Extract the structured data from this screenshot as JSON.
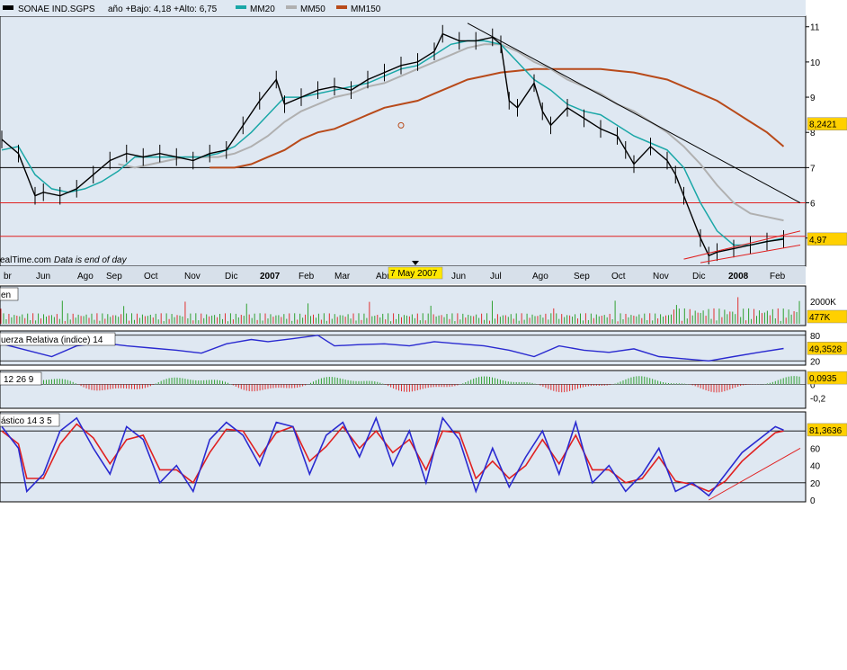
{
  "header": {
    "symbol": "SONAE IND.SGPS",
    "stats": "año +Bajo: 4,18 +Alto: 6,75",
    "legend": [
      {
        "name": "MM20",
        "color": "#1aa7a7"
      },
      {
        "name": "MM50",
        "color": "#b0b0b0"
      },
      {
        "name": "MM150",
        "color": "#b84a1a"
      }
    ]
  },
  "watermark": "ealTime.com",
  "eod_note": "Data is end of day",
  "date_marker": "7 May 2007",
  "panel_labels": {
    "volume": "en",
    "rsi": "uerza Relativa (indice) 14",
    "macd": "12 26 9",
    "stoch": "ástico 14 3 5"
  },
  "x_axis": {
    "labels": [
      {
        "t": "br",
        "bold": false
      },
      {
        "t": "Jun",
        "bold": false
      },
      {
        "t": "Ago",
        "bold": false
      },
      {
        "t": "Sep",
        "bold": false
      },
      {
        "t": "Oct",
        "bold": false
      },
      {
        "t": "Nov",
        "bold": false
      },
      {
        "t": "Dic",
        "bold": false
      },
      {
        "t": "2007",
        "bold": true
      },
      {
        "t": "Feb",
        "bold": false
      },
      {
        "t": "Mar",
        "bold": false
      },
      {
        "t": "Abr",
        "bold": false
      },
      {
        "t": "Jun",
        "bold": false
      },
      {
        "t": "Jul",
        "bold": false
      },
      {
        "t": "Ago",
        "bold": false
      },
      {
        "t": "Sep",
        "bold": false
      },
      {
        "t": "Oct",
        "bold": false
      },
      {
        "t": "Nov",
        "bold": false
      },
      {
        "t": "Dic",
        "bold": false
      },
      {
        "t": "2008",
        "bold": true
      },
      {
        "t": "Feb",
        "bold": false
      }
    ]
  },
  "chart_data": {
    "type": "line",
    "price": {
      "y_ticks": [
        "11",
        "10",
        "9",
        "8",
        "7",
        "6",
        "5"
      ],
      "ylim": [
        4.2,
        11.3
      ],
      "last_value_label": "4,97",
      "ref_value_label": "8,2421",
      "hlines": [
        {
          "value": 7.0,
          "color": "#000000"
        },
        {
          "value": 6.0,
          "color": "#e02020"
        },
        {
          "value": 5.05,
          "color": "#e02020"
        }
      ],
      "close_points": [
        [
          0,
          7.8
        ],
        [
          2,
          7.4
        ],
        [
          4,
          6.2
        ],
        [
          5,
          6.3
        ],
        [
          7,
          6.2
        ],
        [
          9,
          6.4
        ],
        [
          11,
          6.8
        ],
        [
          13,
          7.2
        ],
        [
          15,
          7.4
        ],
        [
          17,
          7.3
        ],
        [
          19,
          7.4
        ],
        [
          21,
          7.3
        ],
        [
          23,
          7.2
        ],
        [
          25,
          7.4
        ],
        [
          27,
          7.5
        ],
        [
          29,
          8.2
        ],
        [
          31,
          8.9
        ],
        [
          33,
          9.5
        ],
        [
          34,
          8.8
        ],
        [
          36,
          9.0
        ],
        [
          38,
          9.2
        ],
        [
          40,
          9.3
        ],
        [
          42,
          9.2
        ],
        [
          44,
          9.5
        ],
        [
          46,
          9.7
        ],
        [
          48,
          9.9
        ],
        [
          50,
          10.0
        ],
        [
          52,
          10.3
        ],
        [
          53,
          10.8
        ],
        [
          55,
          10.6
        ],
        [
          57,
          10.6
        ],
        [
          59,
          10.7
        ],
        [
          60,
          10.5
        ],
        [
          61,
          8.9
        ],
        [
          62,
          8.7
        ],
        [
          64,
          9.4
        ],
        [
          65,
          8.6
        ],
        [
          66,
          8.2
        ],
        [
          68,
          8.7
        ],
        [
          70,
          8.4
        ],
        [
          72,
          8.1
        ],
        [
          74,
          7.9
        ],
        [
          75,
          7.5
        ],
        [
          76,
          7.1
        ],
        [
          78,
          7.6
        ],
        [
          80,
          7.2
        ],
        [
          81,
          6.8
        ],
        [
          82,
          6.2
        ],
        [
          84,
          5.0
        ],
        [
          85,
          4.5
        ],
        [
          86,
          4.6
        ],
        [
          88,
          4.7
        ],
        [
          90,
          4.8
        ],
        [
          92,
          4.9
        ],
        [
          94,
          4.97
        ]
      ],
      "mm20": [
        [
          0,
          7.5
        ],
        [
          2,
          7.6
        ],
        [
          4,
          6.8
        ],
        [
          6,
          6.4
        ],
        [
          8,
          6.3
        ],
        [
          10,
          6.4
        ],
        [
          12,
          6.6
        ],
        [
          14,
          6.9
        ],
        [
          16,
          7.3
        ],
        [
          18,
          7.3
        ],
        [
          20,
          7.3
        ],
        [
          22,
          7.3
        ],
        [
          24,
          7.3
        ],
        [
          26,
          7.4
        ],
        [
          28,
          7.6
        ],
        [
          30,
          8.0
        ],
        [
          32,
          8.5
        ],
        [
          34,
          9.0
        ],
        [
          36,
          9.0
        ],
        [
          38,
          9.1
        ],
        [
          40,
          9.2
        ],
        [
          42,
          9.3
        ],
        [
          44,
          9.4
        ],
        [
          46,
          9.6
        ],
        [
          48,
          9.8
        ],
        [
          50,
          9.9
        ],
        [
          52,
          10.2
        ],
        [
          54,
          10.5
        ],
        [
          56,
          10.6
        ],
        [
          58,
          10.6
        ],
        [
          60,
          10.5
        ],
        [
          62,
          10.0
        ],
        [
          64,
          9.5
        ],
        [
          66,
          9.2
        ],
        [
          68,
          8.8
        ],
        [
          70,
          8.6
        ],
        [
          72,
          8.5
        ],
        [
          74,
          8.2
        ],
        [
          76,
          7.9
        ],
        [
          78,
          7.7
        ],
        [
          80,
          7.5
        ],
        [
          82,
          7.0
        ],
        [
          84,
          6.0
        ],
        [
          86,
          5.2
        ],
        [
          88,
          4.8
        ],
        [
          90,
          4.8
        ],
        [
          92,
          4.9
        ],
        [
          94,
          5.0
        ]
      ],
      "mm50": [
        [
          14,
          7.1
        ],
        [
          16,
          7.0
        ],
        [
          18,
          7.1
        ],
        [
          20,
          7.2
        ],
        [
          22,
          7.3
        ],
        [
          24,
          7.3
        ],
        [
          26,
          7.3
        ],
        [
          28,
          7.4
        ],
        [
          30,
          7.6
        ],
        [
          32,
          7.9
        ],
        [
          34,
          8.3
        ],
        [
          36,
          8.6
        ],
        [
          38,
          8.8
        ],
        [
          40,
          9.0
        ],
        [
          42,
          9.1
        ],
        [
          44,
          9.3
        ],
        [
          46,
          9.4
        ],
        [
          48,
          9.6
        ],
        [
          50,
          9.8
        ],
        [
          52,
          10.0
        ],
        [
          54,
          10.2
        ],
        [
          56,
          10.4
        ],
        [
          58,
          10.5
        ],
        [
          60,
          10.5
        ],
        [
          62,
          10.3
        ],
        [
          64,
          10.0
        ],
        [
          66,
          9.8
        ],
        [
          68,
          9.5
        ],
        [
          70,
          9.3
        ],
        [
          72,
          9.1
        ],
        [
          74,
          8.8
        ],
        [
          76,
          8.6
        ],
        [
          78,
          8.3
        ],
        [
          80,
          8.0
        ],
        [
          82,
          7.6
        ],
        [
          84,
          7.1
        ],
        [
          86,
          6.5
        ],
        [
          88,
          6.0
        ],
        [
          90,
          5.7
        ],
        [
          92,
          5.6
        ],
        [
          94,
          5.5
        ]
      ],
      "mm150": [
        [
          25,
          7.0
        ],
        [
          28,
          7.0
        ],
        [
          30,
          7.1
        ],
        [
          32,
          7.3
        ],
        [
          34,
          7.5
        ],
        [
          36,
          7.8
        ],
        [
          38,
          8.0
        ],
        [
          40,
          8.1
        ],
        [
          42,
          8.3
        ],
        [
          44,
          8.5
        ],
        [
          46,
          8.7
        ],
        [
          48,
          8.8
        ],
        [
          50,
          8.9
        ],
        [
          52,
          9.1
        ],
        [
          54,
          9.3
        ],
        [
          56,
          9.5
        ],
        [
          58,
          9.6
        ],
        [
          60,
          9.7
        ],
        [
          62,
          9.75
        ],
        [
          64,
          9.8
        ],
        [
          66,
          9.8
        ],
        [
          68,
          9.8
        ],
        [
          70,
          9.8
        ],
        [
          72,
          9.8
        ],
        [
          74,
          9.75
        ],
        [
          76,
          9.7
        ],
        [
          78,
          9.6
        ],
        [
          80,
          9.5
        ],
        [
          82,
          9.3
        ],
        [
          84,
          9.1
        ],
        [
          86,
          8.9
        ],
        [
          88,
          8.6
        ],
        [
          90,
          8.3
        ],
        [
          92,
          8.0
        ],
        [
          94,
          7.6
        ]
      ],
      "trendlines": [
        {
          "from": [
            56,
            11.1
          ],
          "to": [
            96,
            6.0
          ],
          "color": "#000000"
        },
        {
          "from": [
            82,
            4.4
          ],
          "to": [
            96,
            5.2
          ],
          "color": "#e02020"
        },
        {
          "from": [
            84,
            4.3
          ],
          "to": [
            96,
            4.8
          ],
          "color": "#e02020"
        }
      ]
    },
    "volume": {
      "y_ticks": [
        "2000K"
      ],
      "last_value_label": "477K",
      "ymax": 3000
    },
    "rsi": {
      "y_ticks": [
        "80",
        "20"
      ],
      "last_value_label": "49,3528",
      "ylim": [
        10,
        90
      ],
      "points": [
        [
          0,
          60
        ],
        [
          3,
          45
        ],
        [
          6,
          30
        ],
        [
          9,
          55
        ],
        [
          12,
          62
        ],
        [
          15,
          55
        ],
        [
          18,
          50
        ],
        [
          21,
          45
        ],
        [
          24,
          38
        ],
        [
          27,
          60
        ],
        [
          30,
          70
        ],
        [
          32,
          65
        ],
        [
          35,
          72
        ],
        [
          38,
          80
        ],
        [
          40,
          55
        ],
        [
          43,
          58
        ],
        [
          46,
          60
        ],
        [
          49,
          55
        ],
        [
          52,
          65
        ],
        [
          55,
          60
        ],
        [
          58,
          55
        ],
        [
          61,
          45
        ],
        [
          64,
          30
        ],
        [
          67,
          55
        ],
        [
          70,
          45
        ],
        [
          73,
          40
        ],
        [
          76,
          48
        ],
        [
          79,
          30
        ],
        [
          82,
          25
        ],
        [
          85,
          20
        ],
        [
          88,
          30
        ],
        [
          91,
          40
        ],
        [
          94,
          49
        ]
      ]
    },
    "macd": {
      "y_ticks": [
        "0",
        "-0,2"
      ],
      "last_value_label": "0,0935",
      "ylim": [
        -0.35,
        0.2
      ]
    },
    "stoch": {
      "y_ticks": [
        "80",
        "60",
        "40",
        "20",
        "0"
      ],
      "last_value_label": "81,3636",
      "ylim": [
        0,
        100
      ],
      "k": [
        [
          0,
          85
        ],
        [
          2,
          60
        ],
        [
          3,
          10
        ],
        [
          5,
          30
        ],
        [
          7,
          80
        ],
        [
          9,
          95
        ],
        [
          11,
          60
        ],
        [
          13,
          30
        ],
        [
          15,
          85
        ],
        [
          17,
          70
        ],
        [
          19,
          20
        ],
        [
          21,
          40
        ],
        [
          23,
          10
        ],
        [
          25,
          70
        ],
        [
          27,
          90
        ],
        [
          29,
          75
        ],
        [
          31,
          40
        ],
        [
          33,
          90
        ],
        [
          35,
          85
        ],
        [
          37,
          30
        ],
        [
          39,
          75
        ],
        [
          41,
          90
        ],
        [
          43,
          50
        ],
        [
          45,
          95
        ],
        [
          47,
          40
        ],
        [
          49,
          80
        ],
        [
          51,
          20
        ],
        [
          53,
          95
        ],
        [
          55,
          70
        ],
        [
          57,
          10
        ],
        [
          59,
          60
        ],
        [
          61,
          15
        ],
        [
          63,
          50
        ],
        [
          65,
          80
        ],
        [
          67,
          30
        ],
        [
          69,
          90
        ],
        [
          71,
          20
        ],
        [
          73,
          40
        ],
        [
          75,
          10
        ],
        [
          77,
          30
        ],
        [
          79,
          60
        ],
        [
          81,
          10
        ],
        [
          83,
          20
        ],
        [
          85,
          5
        ],
        [
          87,
          30
        ],
        [
          89,
          55
        ],
        [
          91,
          70
        ],
        [
          93,
          85
        ],
        [
          94,
          81
        ]
      ],
      "d": [
        [
          0,
          80
        ],
        [
          2,
          65
        ],
        [
          3,
          25
        ],
        [
          5,
          25
        ],
        [
          7,
          65
        ],
        [
          9,
          88
        ],
        [
          11,
          72
        ],
        [
          13,
          42
        ],
        [
          15,
          70
        ],
        [
          17,
          75
        ],
        [
          19,
          35
        ],
        [
          21,
          35
        ],
        [
          23,
          20
        ],
        [
          25,
          55
        ],
        [
          27,
          82
        ],
        [
          29,
          80
        ],
        [
          31,
          50
        ],
        [
          33,
          78
        ],
        [
          35,
          85
        ],
        [
          37,
          45
        ],
        [
          39,
          62
        ],
        [
          41,
          85
        ],
        [
          43,
          60
        ],
        [
          45,
          80
        ],
        [
          47,
          55
        ],
        [
          49,
          70
        ],
        [
          51,
          35
        ],
        [
          53,
          80
        ],
        [
          55,
          78
        ],
        [
          57,
          25
        ],
        [
          59,
          45
        ],
        [
          61,
          25
        ],
        [
          63,
          40
        ],
        [
          65,
          70
        ],
        [
          67,
          42
        ],
        [
          69,
          75
        ],
        [
          71,
          35
        ],
        [
          73,
          35
        ],
        [
          75,
          20
        ],
        [
          77,
          25
        ],
        [
          79,
          50
        ],
        [
          81,
          22
        ],
        [
          83,
          18
        ],
        [
          85,
          10
        ],
        [
          87,
          22
        ],
        [
          89,
          45
        ],
        [
          91,
          62
        ],
        [
          93,
          78
        ],
        [
          94,
          80
        ]
      ]
    }
  }
}
